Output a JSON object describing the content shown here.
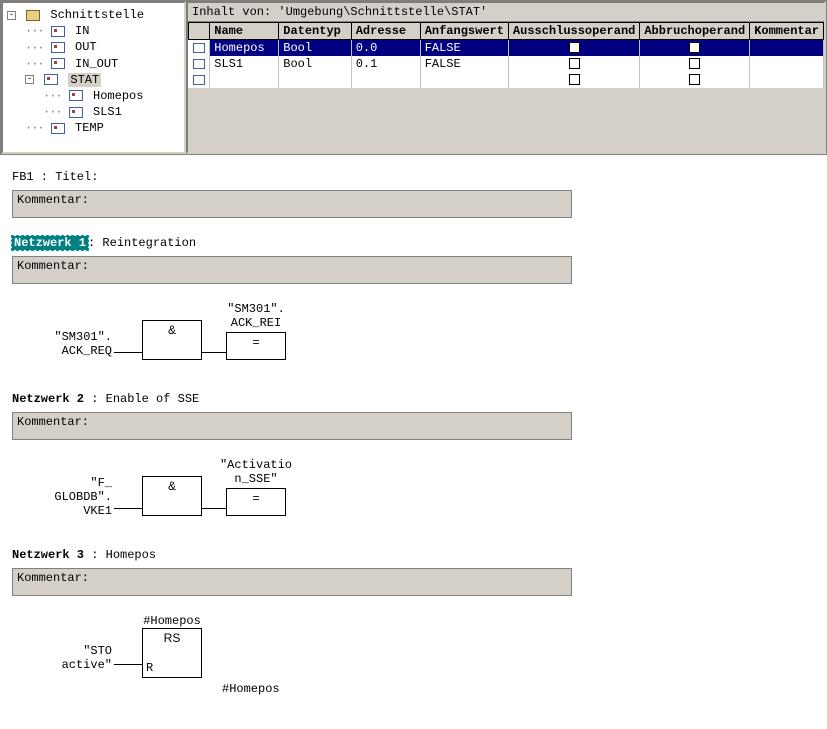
{
  "tree": {
    "root": "Schnittstelle",
    "in": "IN",
    "out": "OUT",
    "inout": "IN_OUT",
    "stat": "STAT",
    "stat_children": [
      "Homepos",
      "SLS1"
    ],
    "temp": "TEMP"
  },
  "table": {
    "title": "Inhalt von: 'Umgebung\\Schnittstelle\\STAT'",
    "headers": {
      "name": "Name",
      "datentyp": "Datentyp",
      "adresse": "Adresse",
      "anfangswert": "Anfangswert",
      "ausschluss": "Ausschlussoperand",
      "abbruch": "Abbruchoperand",
      "kommentar": "Kommentar"
    },
    "rows": [
      {
        "name": "Homepos",
        "type": "Bool",
        "addr": "0.0",
        "init": "FALSE"
      },
      {
        "name": "SLS1",
        "type": "Bool",
        "addr": "0.1",
        "init": "FALSE"
      }
    ]
  },
  "editor": {
    "fb_title": "FB1 : Titel:",
    "kommentar_label": "Kommentar:",
    "networks": [
      {
        "label": "Netzwerk 1",
        "title": ": Reintegration",
        "highlighted": true,
        "input_signal": "\"SM301\".\nACK_REQ",
        "box1": "&",
        "output_signal": "\"SM301\".\nACK_REI",
        "box2": "="
      },
      {
        "label": "Netzwerk 2",
        "title": " : Enable of SSE",
        "highlighted": false,
        "input_signal": "\"F_\nGLOBDB\".\nVKE1",
        "box1": "&",
        "output_signal": "\"Activatio\nn_SSE\"",
        "box2": "="
      },
      {
        "label": "Netzwerk 3",
        "title": " : Homepos",
        "highlighted": false,
        "input_signal": "\"STO\nactive\"",
        "box1": "RS",
        "top_signal": "#Homepos",
        "port": "R",
        "bottom_signal": "#Homepos"
      }
    ]
  }
}
